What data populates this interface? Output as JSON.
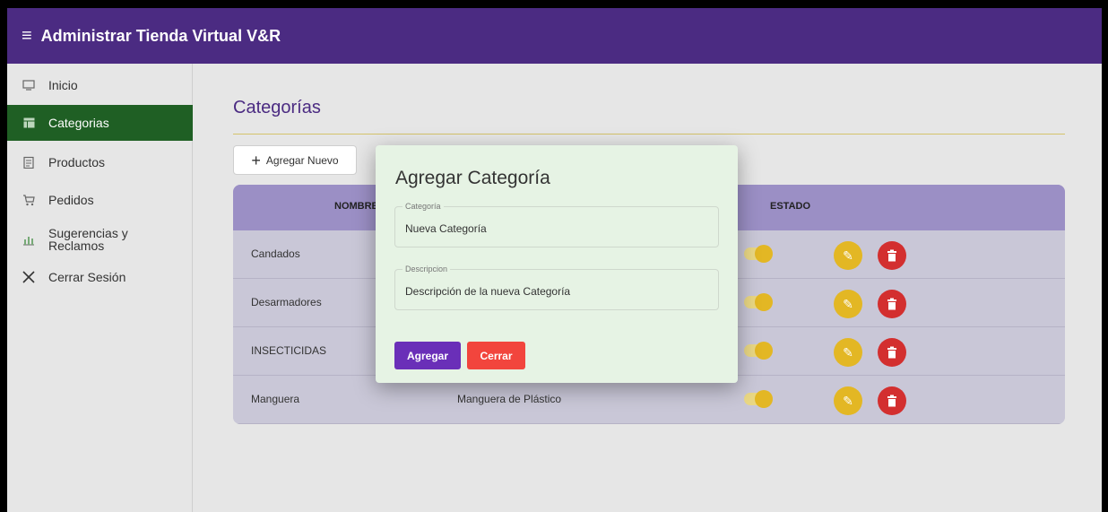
{
  "app": {
    "title": "Administrar Tienda Virtual V&R"
  },
  "sidebar": {
    "items": [
      {
        "label": "Inicio",
        "icon": "monitor-icon"
      },
      {
        "label": "Categorias",
        "icon": "table-icon"
      },
      {
        "label": "Productos",
        "icon": "clipboard-icon"
      },
      {
        "label": "Pedidos",
        "icon": "cart-icon"
      },
      {
        "label": "Sugerencias y",
        "label2": "Reclamos",
        "icon": "chart-icon"
      },
      {
        "label": "Cerrar Sesión",
        "icon": "close-icon"
      }
    ]
  },
  "main": {
    "title": "Categorías",
    "add_button": "Agregar Nuevo",
    "table": {
      "headers": {
        "nombre": "NOMBRE",
        "estado": "ESTADO"
      },
      "rows": [
        {
          "nombre": "Candados",
          "descripcion": ""
        },
        {
          "nombre": "Desarmadores",
          "descripcion": ""
        },
        {
          "nombre": "INSECTICIDAS",
          "descripcion": ""
        },
        {
          "nombre": "Manguera",
          "descripcion": "Manguera de Plástico"
        }
      ]
    }
  },
  "dialog": {
    "title": "Agregar Categoría",
    "fields": [
      {
        "label": "Categoría",
        "value": "Nueva Categoría"
      },
      {
        "label": "Descripcion",
        "value": "Descripción de la nueva Categoría"
      }
    ],
    "primary_button": "Agregar",
    "close_button": "Cerrar"
  },
  "colors": {
    "appbar": "#4b2b82",
    "active_sidebar": "#1f5f24",
    "edit": "#e3b724",
    "delete": "#d32f2f",
    "agregar": "#6a2fb8",
    "cerrar": "#f2453d"
  }
}
